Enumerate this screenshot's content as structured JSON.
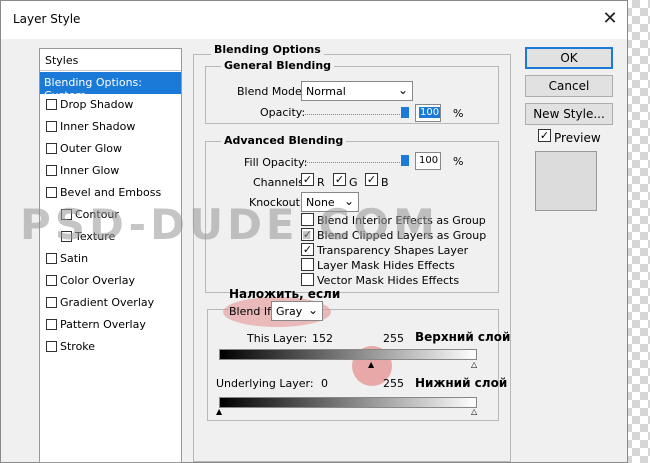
{
  "window": {
    "title": "Layer Style",
    "close_glyph": "✕"
  },
  "styles_panel": {
    "header": "Styles",
    "items": [
      {
        "label": "Blending Options: Custom",
        "selected": true,
        "checkbox": false
      },
      {
        "label": "Drop Shadow"
      },
      {
        "label": "Inner Shadow"
      },
      {
        "label": "Outer Glow"
      },
      {
        "label": "Inner Glow"
      },
      {
        "label": "Bevel and Emboss"
      },
      {
        "label": "Contour",
        "indent": true
      },
      {
        "label": "Texture",
        "indent": true
      },
      {
        "label": "Satin"
      },
      {
        "label": "Color Overlay"
      },
      {
        "label": "Gradient Overlay"
      },
      {
        "label": "Pattern Overlay"
      },
      {
        "label": "Stroke"
      }
    ]
  },
  "blending_options": {
    "title": "Blending Options",
    "general": {
      "title": "General Blending",
      "blend_mode_label": "Blend Mode:",
      "blend_mode_value": "Normal",
      "opacity_label": "Opacity:",
      "opacity_value": "100",
      "percent": "%"
    },
    "advanced": {
      "title": "Advanced Blending",
      "fill_opacity_label": "Fill Opacity:",
      "fill_opacity_value": "100",
      "percent": "%",
      "channels_label": "Channels:",
      "channels": [
        "R",
        "G",
        "B"
      ],
      "knockout_label": "Knockout:",
      "knockout_value": "None",
      "options": [
        {
          "label": "Blend Interior Effects as Group",
          "checked": false
        },
        {
          "label": "Blend Clipped Layers as Group",
          "checked": true
        },
        {
          "label": "Transparency Shapes Layer",
          "checked": true
        },
        {
          "label": "Layer Mask Hides Effects",
          "checked": false
        },
        {
          "label": "Vector Mask Hides Effects",
          "checked": false
        }
      ]
    },
    "blend_if": {
      "label": "Blend If:",
      "value": "Gray",
      "this_layer_label": "This Layer:",
      "this_layer_low": "152",
      "this_layer_high": "255",
      "underlying_label": "Underlying Layer:",
      "underlying_low": "0",
      "underlying_high": "255"
    }
  },
  "buttons": {
    "ok": "OK",
    "cancel": "Cancel",
    "new_style": "New Style...",
    "preview": "Preview",
    "preview_checked": true
  },
  "annotations": {
    "blend_if": "Наложить, если",
    "this_layer": "Верхний слой",
    "underlying": "Нижний слой"
  },
  "watermark": "PSD-DUDE.COM",
  "colors": {
    "accent": "#1b7ad8",
    "highlight": "#e26e6e"
  },
  "icons": {
    "chevron": "chevron-down-icon",
    "check": "checkmark-icon",
    "close": "close-icon"
  }
}
